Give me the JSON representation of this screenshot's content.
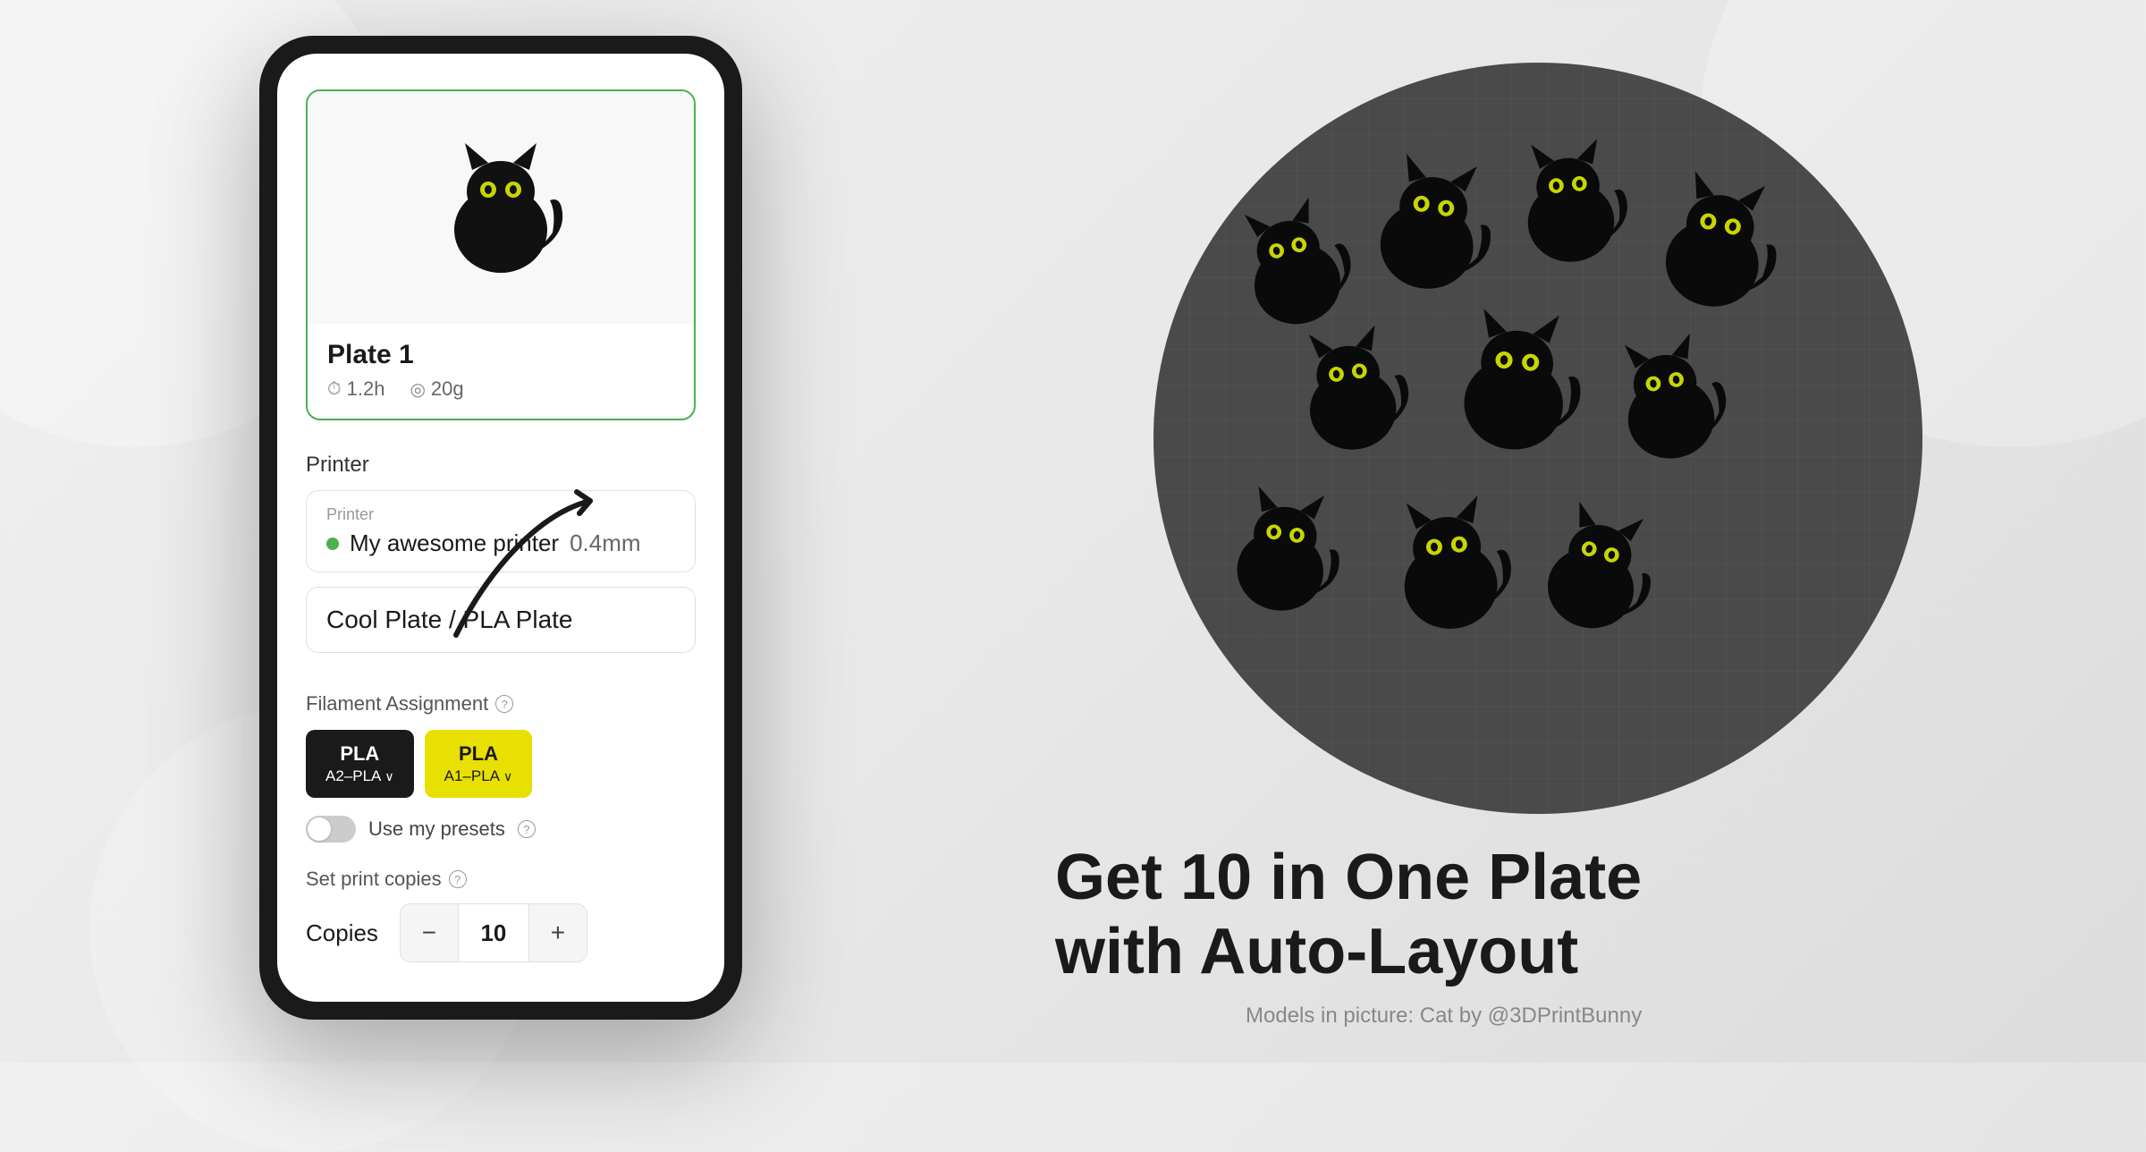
{
  "background": {
    "color": "#eeeeee"
  },
  "phone": {
    "plate_card": {
      "name": "Plate 1",
      "time": "1.2h",
      "weight": "20g"
    },
    "printer_section_label": "Printer",
    "printer_box": {
      "label": "Printer",
      "name": "My awesome printer",
      "size": "0.4mm"
    },
    "plate_type": "Cool Plate / PLA Plate",
    "filament": {
      "header": "Filament Assignment",
      "chip1_material": "PLA",
      "chip1_sub": "A2–PLA",
      "chip2_material": "PLA",
      "chip2_sub": "A1–PLA"
    },
    "toggle_label": "Use my presets",
    "copies": {
      "label": "Set print copies",
      "copies_label": "Copies",
      "value": "10"
    }
  },
  "right": {
    "headline_line1": "Get 10 in One Plate",
    "headline_line2": "with Auto-Layout",
    "attribution": "Models in picture: Cat by @3DPrintBunny"
  },
  "icons": {
    "clock": "⏰",
    "weight": "⚖",
    "info": "?"
  }
}
